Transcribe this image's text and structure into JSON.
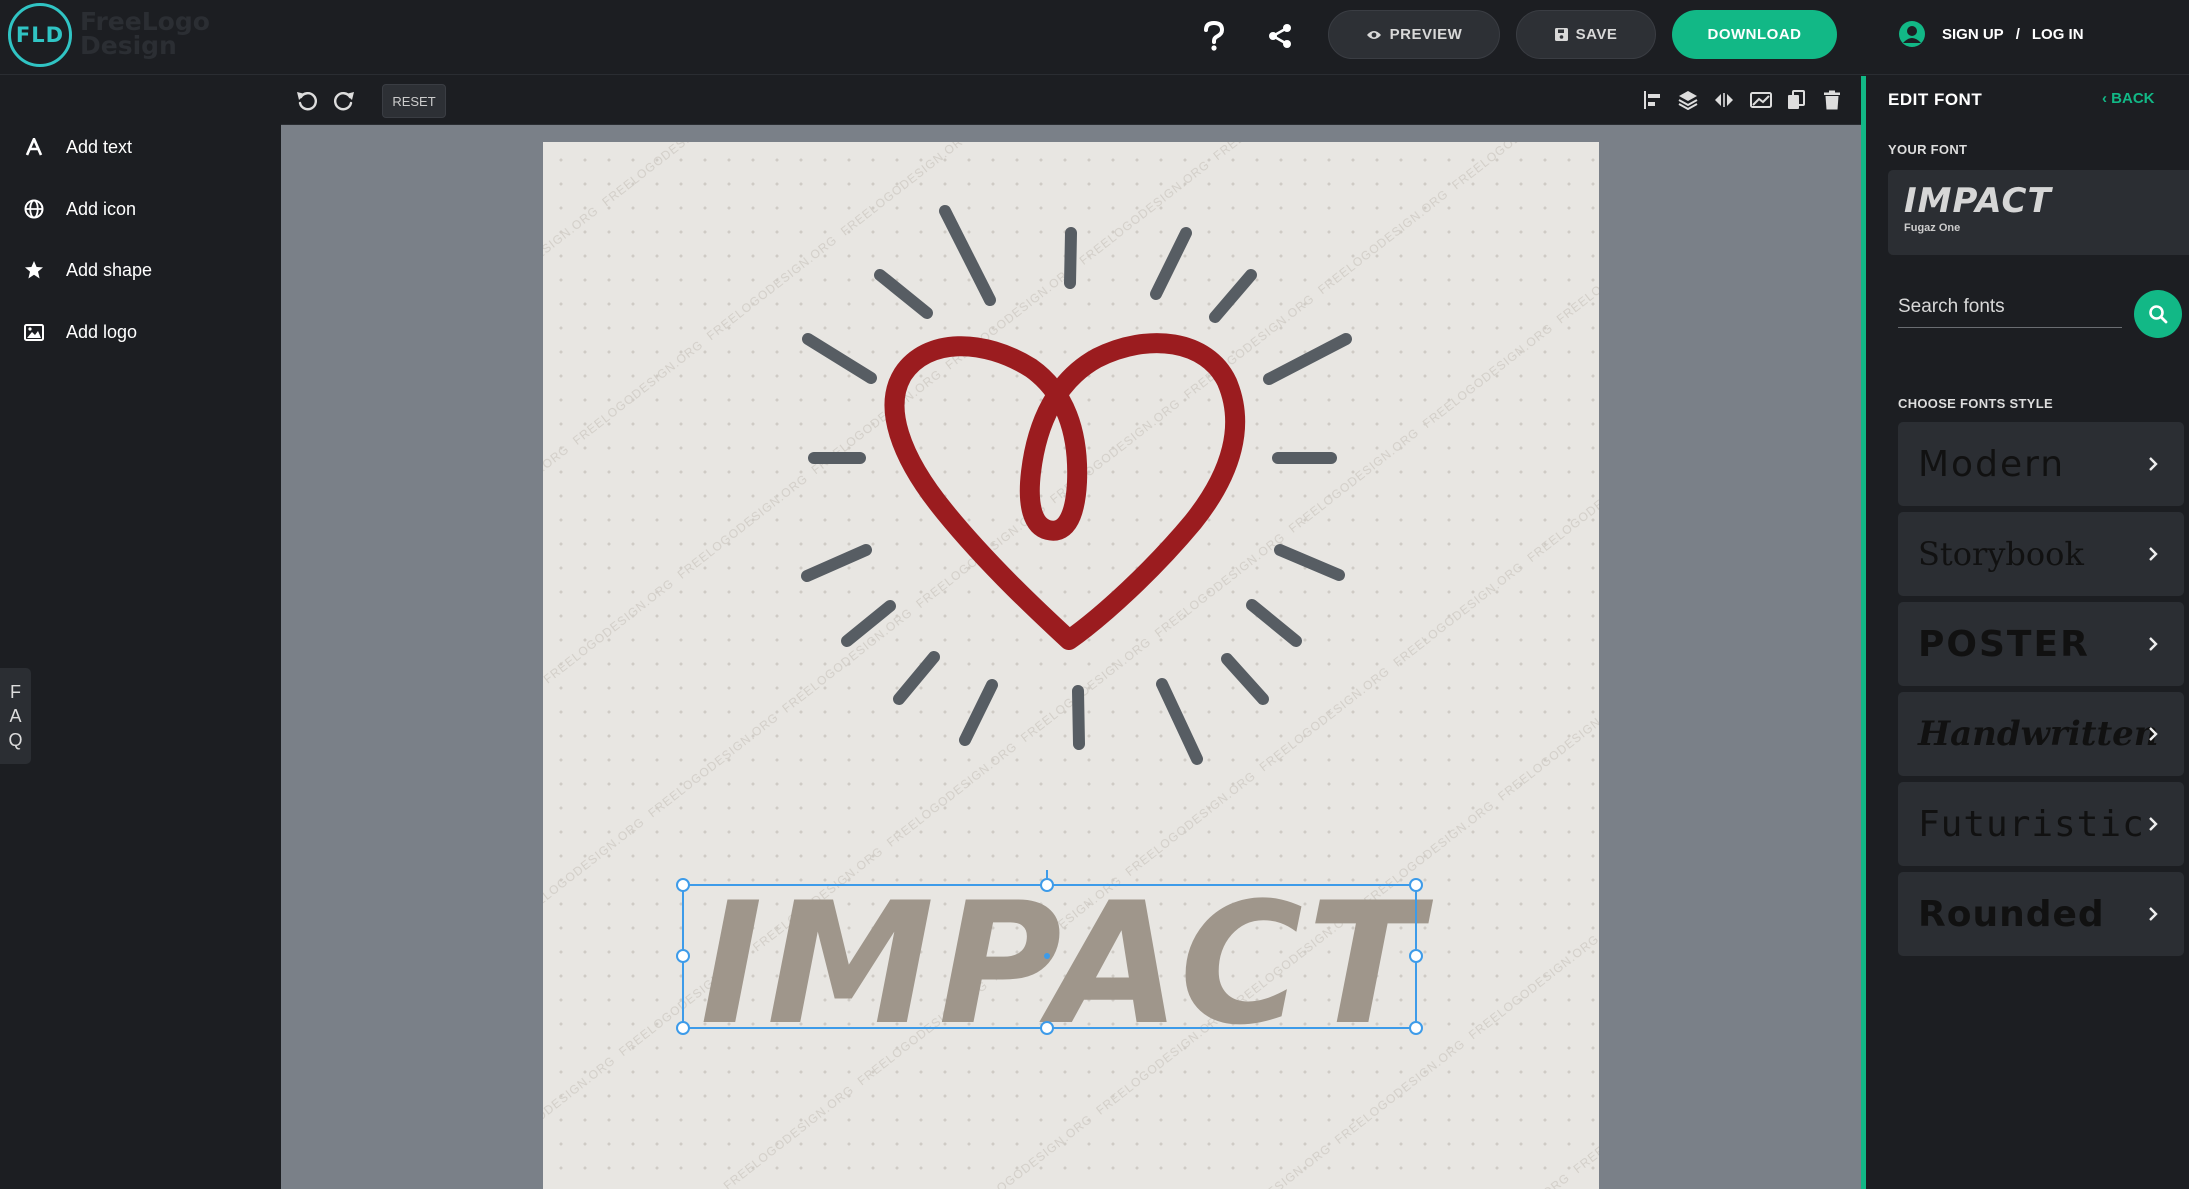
{
  "brand": {
    "monogram": "FLD",
    "wordmark_line1": "FreeLogo",
    "wordmark_line2": "Design"
  },
  "header": {
    "help_icon": "question-icon",
    "share_icon": "share-icon",
    "preview_label": "PREVIEW",
    "save_label": "SAVE",
    "download_label": "DOWNLOAD",
    "sign_up_label": "SIGN UP",
    "auth_separator": "/",
    "log_in_label": "LOG IN"
  },
  "sidebar": {
    "items": [
      {
        "label": "Add text",
        "icon": "text-icon"
      },
      {
        "label": "Add icon",
        "icon": "globe-icon"
      },
      {
        "label": "Add shape",
        "icon": "star-icon"
      },
      {
        "label": "Add logo",
        "icon": "image-icon"
      }
    ],
    "faq_letters": [
      "F",
      "A",
      "Q"
    ]
  },
  "toolbar": {
    "reset_label": "RESET",
    "tools": [
      "undo-icon",
      "redo-icon",
      "align-icon",
      "layers-icon",
      "flip-icon",
      "mask-icon",
      "duplicate-icon",
      "delete-icon"
    ]
  },
  "canvas": {
    "text_element": "IMPACT",
    "text_color": "#9f968b",
    "heart_color": "#9b1c1f",
    "rays_color": "#575d63",
    "artboard_color": "#e8e6e2",
    "watermark": "FREELOGODESIGN.ORG"
  },
  "right_panel": {
    "title": "EDIT FONT",
    "back_label": "BACK",
    "your_font_label": "YOUR FONT",
    "current_font_preview": "IMPACT",
    "current_font_name": "Fugaz One",
    "search_placeholder": "Search fonts",
    "choose_label": "CHOOSE FONTS STYLE",
    "styles": [
      "Modern",
      "Storybook",
      "POSTER",
      "Handwritten",
      "Futuristic",
      "Rounded"
    ]
  },
  "colors": {
    "accent": "#12b886",
    "logo_ring": "#30c4c4",
    "selection": "#3d9be9"
  }
}
